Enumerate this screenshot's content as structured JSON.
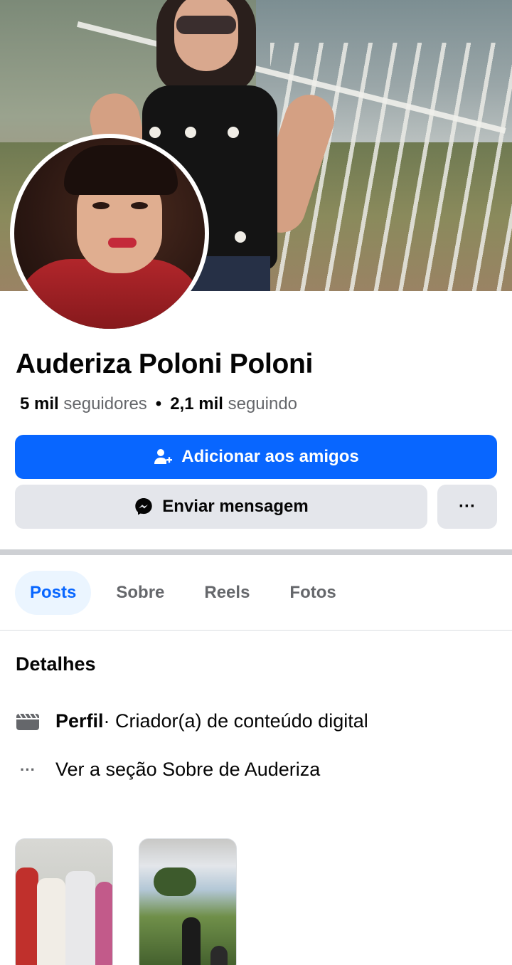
{
  "profile": {
    "name": "Auderiza Poloni Poloni",
    "followers_count": "5 mil",
    "followers_label": "seguidores",
    "following_count": "2,1 mil",
    "following_label": "seguindo",
    "separator": "•"
  },
  "actions": {
    "add_friend": "Adicionar aos amigos",
    "send_message": "Enviar mensagem",
    "more": "···"
  },
  "tabs": [
    {
      "label": "Posts",
      "active": true
    },
    {
      "label": "Sobre",
      "active": false
    },
    {
      "label": "Reels",
      "active": false
    },
    {
      "label": "Fotos",
      "active": false
    }
  ],
  "details": {
    "title": "Detalhes",
    "profile_type_bold": "Perfil",
    "profile_type_rest": " · Criador(a) de conteúdo digital",
    "see_about": "Ver a seção Sobre de Auderiza",
    "more_icon_text": "···"
  },
  "colors": {
    "brand_blue": "#0866ff",
    "secondary_button": "#e4e6eb",
    "active_tab_bg": "#ebf5ff",
    "muted_text": "#65676b"
  },
  "icons": {
    "add_friend": "add-friend-icon",
    "messenger": "messenger-icon",
    "more": "more-dots-icon",
    "profile_type": "clapperboard-icon",
    "see_about": "ellipsis-icon"
  }
}
